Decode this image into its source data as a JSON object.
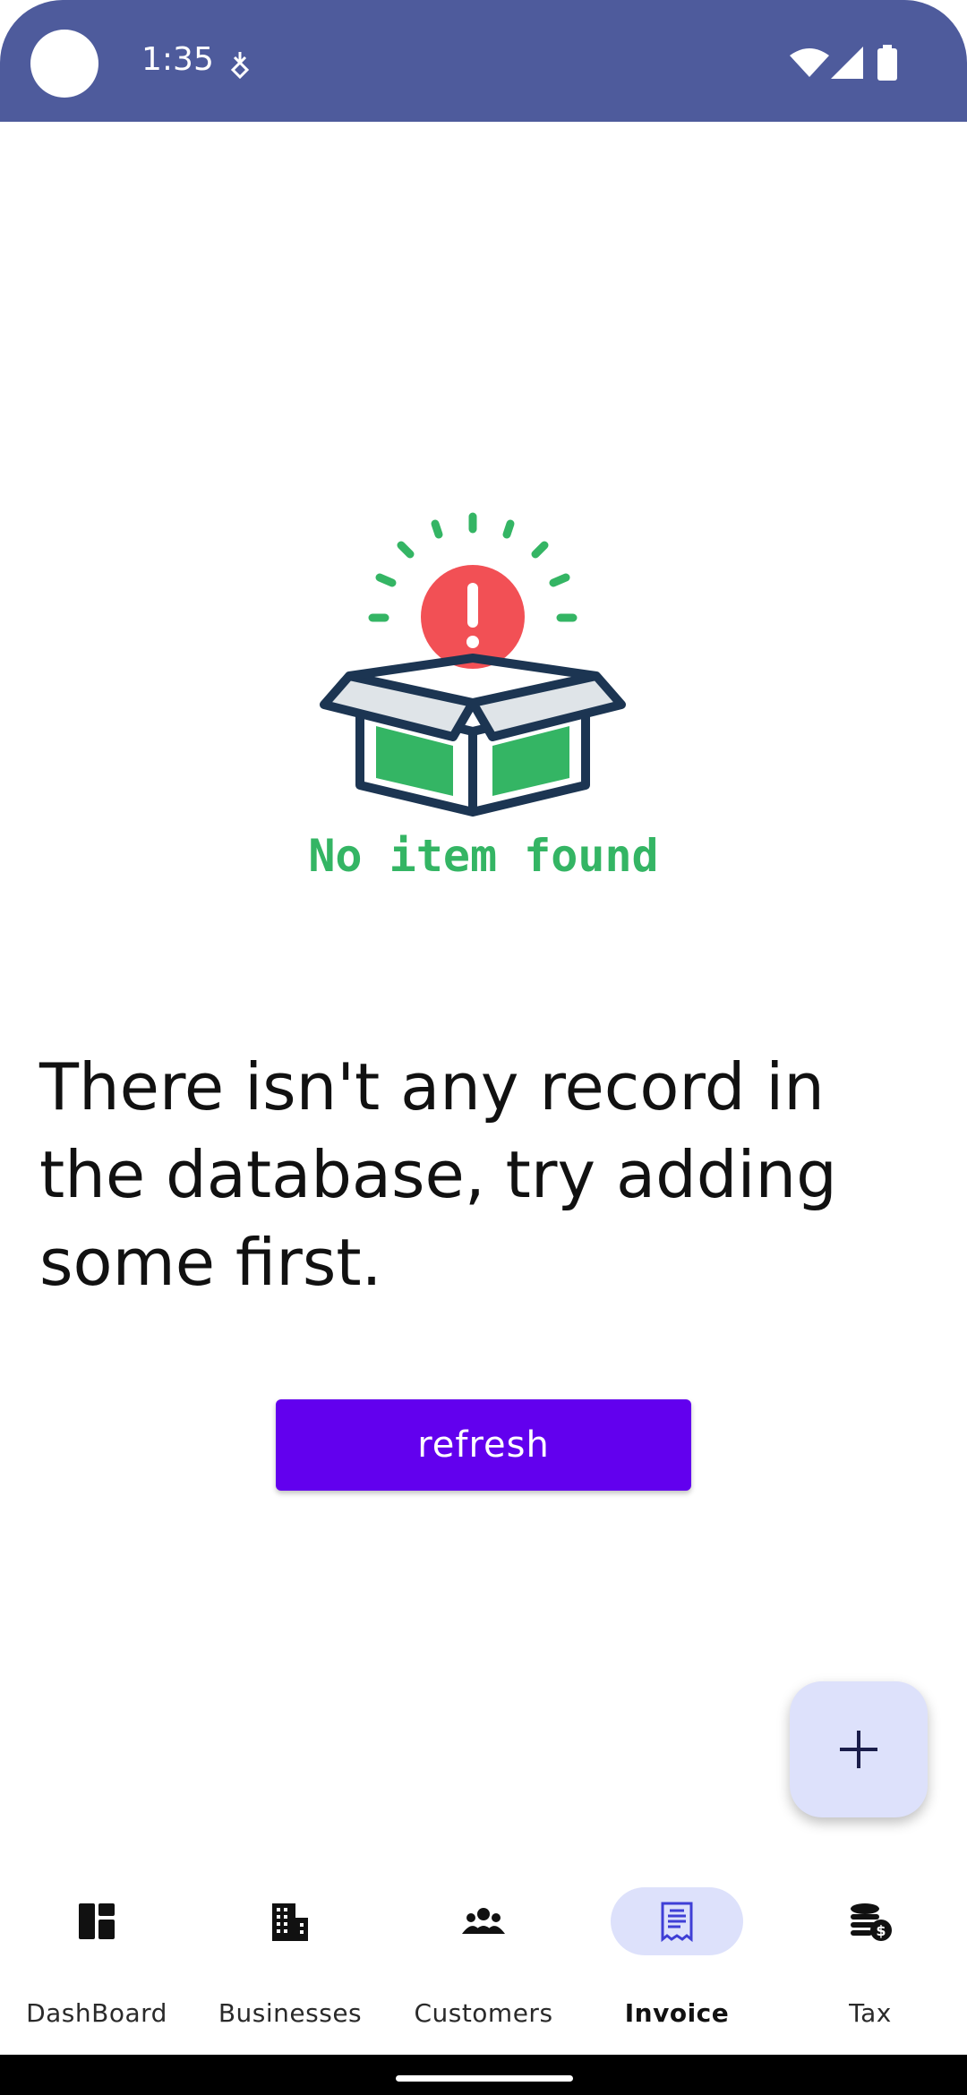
{
  "status_bar": {
    "time": "1:35"
  },
  "empty_state": {
    "illustration_caption": "No item found",
    "message": "There isn't any record in the database, try adding some first.",
    "refresh_label": "refresh"
  },
  "fab": {
    "icon": "plus-icon"
  },
  "bottom_nav": {
    "items": [
      {
        "label": "DashBoard",
        "icon": "dashboard-icon",
        "active": false
      },
      {
        "label": "Businesses",
        "icon": "building-icon",
        "active": false
      },
      {
        "label": "Customers",
        "icon": "people-icon",
        "active": false
      },
      {
        "label": "Invoice",
        "icon": "receipt-icon",
        "active": true
      },
      {
        "label": "Tax",
        "icon": "coins-dollar-icon",
        "active": false
      }
    ]
  },
  "colors": {
    "status_bar": "#4e5b9c",
    "primary_button": "#6200ee",
    "fab_bg": "#dde1fb",
    "nav_active_pill": "#dde1fb",
    "illustration_green": "#34b564",
    "illustration_red": "#f25055",
    "illustration_outline": "#1c3552"
  }
}
